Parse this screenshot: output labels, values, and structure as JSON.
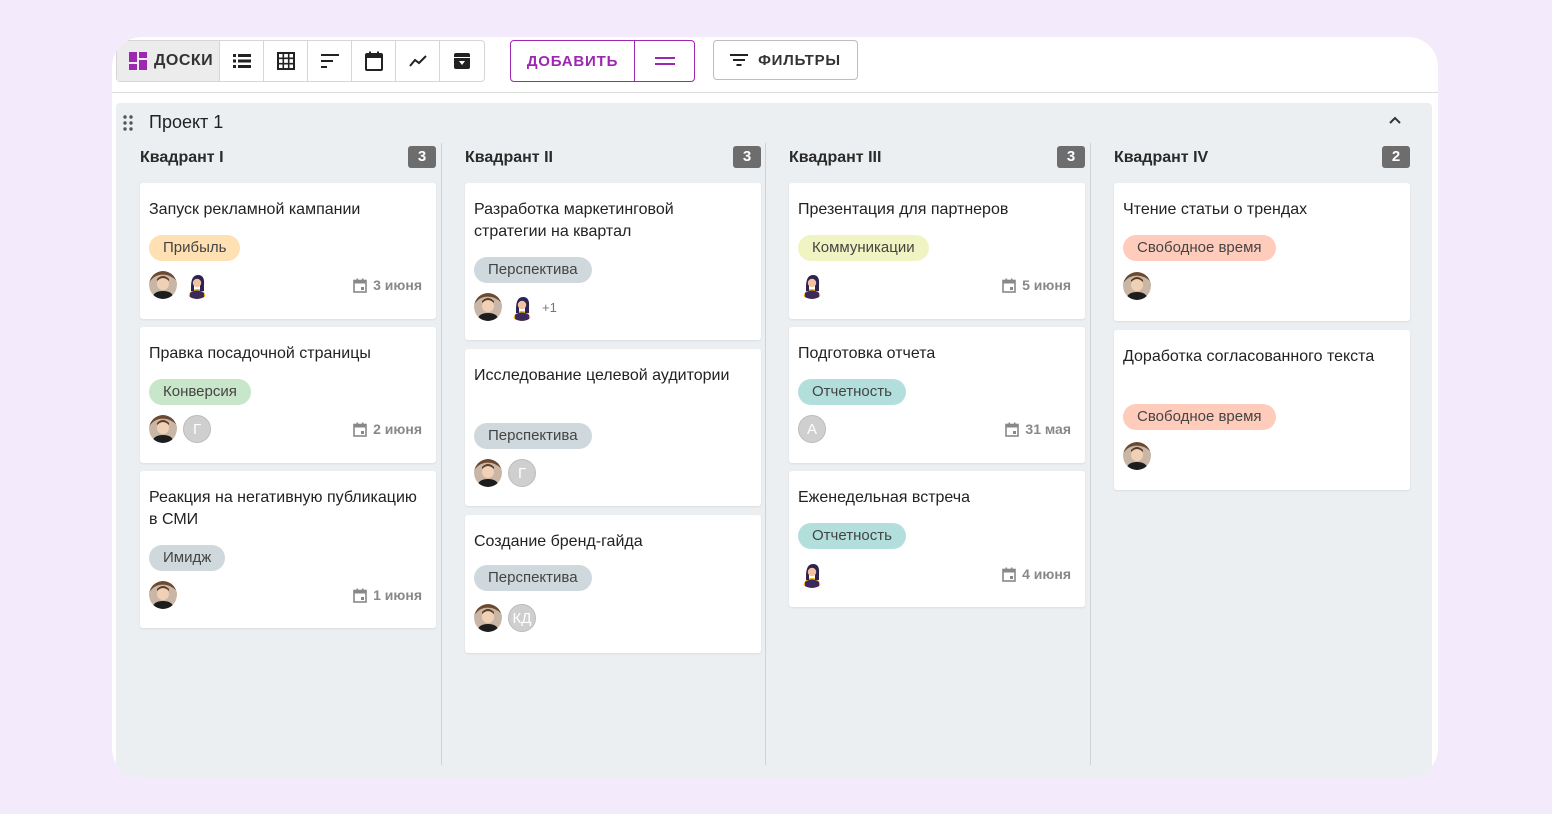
{
  "toolbar": {
    "boards_label": "ДОСКИ",
    "add_label": "ДОБАВИТЬ",
    "filters_label": "ФИЛЬТРЫ"
  },
  "board": {
    "title": "Проект 1",
    "columns": [
      {
        "title": "Квадрант I",
        "count": "3",
        "cards": [
          {
            "title": "Запуск рекламной кампании",
            "tag": "Прибыль",
            "tag_color": "#ffe0b2",
            "date": "3 июня"
          },
          {
            "title": "Правка посадочной страницы",
            "tag": "Конверсия",
            "tag_color": "#c8e6c9",
            "initials": [
              "Г"
            ],
            "date": "2 июня"
          },
          {
            "title": "Реакция на негативную публикацию в СМИ",
            "tag": "Имидж",
            "tag_color": "#cfd8dc",
            "date": "1 июня"
          }
        ]
      },
      {
        "title": "Квадрант II",
        "count": "3",
        "cards": [
          {
            "title": "Разработка маркетинговой стратегии на квартал",
            "tag": "Перспектива",
            "tag_color": "#cfd8dc",
            "extra": "+1"
          },
          {
            "title": "Исследование целевой аудитории",
            "tag": "Перспектива",
            "tag_color": "#cfd8dc",
            "initials": [
              "Г"
            ]
          },
          {
            "title": "Создание бренд-гайда",
            "tag": "Перспектива",
            "tag_color": "#cfd8dc",
            "initials": [
              "КД"
            ]
          }
        ]
      },
      {
        "title": "Квадрант III",
        "count": "3",
        "cards": [
          {
            "title": "Презентация для партнеров",
            "tag": "Коммуникации",
            "tag_color": "#f0f4c3",
            "date": "5 июня"
          },
          {
            "title": "Подготовка отчета",
            "tag": "Отчетность",
            "tag_color": "#b2dfdb",
            "initials": [
              "А"
            ],
            "date": "31 мая"
          },
          {
            "title": "Еженедельная встреча",
            "tag": "Отчетность",
            "tag_color": "#b2dfdb",
            "date": "4 июня"
          }
        ]
      },
      {
        "title": "Квадрант IV",
        "count": "2",
        "cards": [
          {
            "title": "Чтение статьи о трендах",
            "tag": "Свободное время",
            "tag_color": "#ffccbc"
          },
          {
            "title": "Доработка согласованного текста",
            "tag": "Свободное время",
            "tag_color": "#ffccbc"
          }
        ]
      }
    ]
  },
  "colors": {
    "accent": "#9c27b0",
    "board_bg": "#eceff1",
    "page_bg": "#f3eafb"
  }
}
